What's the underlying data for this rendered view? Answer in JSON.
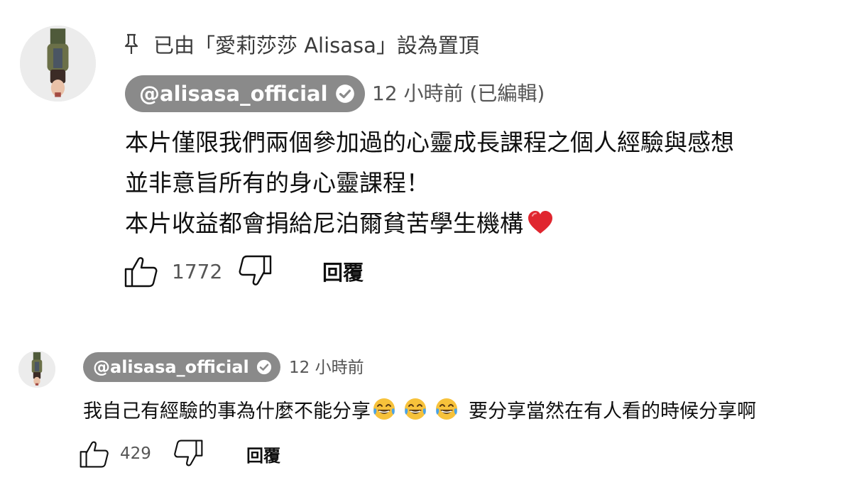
{
  "comments": [
    {
      "pinned_text": "已由「愛莉莎莎 Alisasa」設為置頂",
      "author": "@alisasa_official",
      "time": "12 小時前 (已編輯)",
      "lines": [
        "本片僅限我們兩個參加過的心靈成長課程之個人經驗與感想",
        "並非意旨所有的身心靈課程！",
        "本片收益都會捐給尼泊爾貧苦學生機構"
      ],
      "like_count": "1772",
      "reply_label": "回覆"
    },
    {
      "author": "@alisasa_official",
      "time": "12 小時前",
      "text_before": "我自己有經驗的事為什麼不能分享",
      "text_after": "要分享當然在有人看的時候分享啊",
      "like_count": "429",
      "reply_label": "回覆"
    }
  ],
  "icons": {
    "pin": "pin-icon",
    "verified": "verified-check-icon",
    "like": "thumb-up-icon",
    "dislike": "thumb-down-icon",
    "heart": "red-heart-emoji",
    "laugh": "tears-of-joy-emoji"
  },
  "colors": {
    "chip_bg": "#8a8a8a",
    "meta_text": "#555555",
    "heart": "#e0262f",
    "emoji_face": "#f7c23b"
  }
}
